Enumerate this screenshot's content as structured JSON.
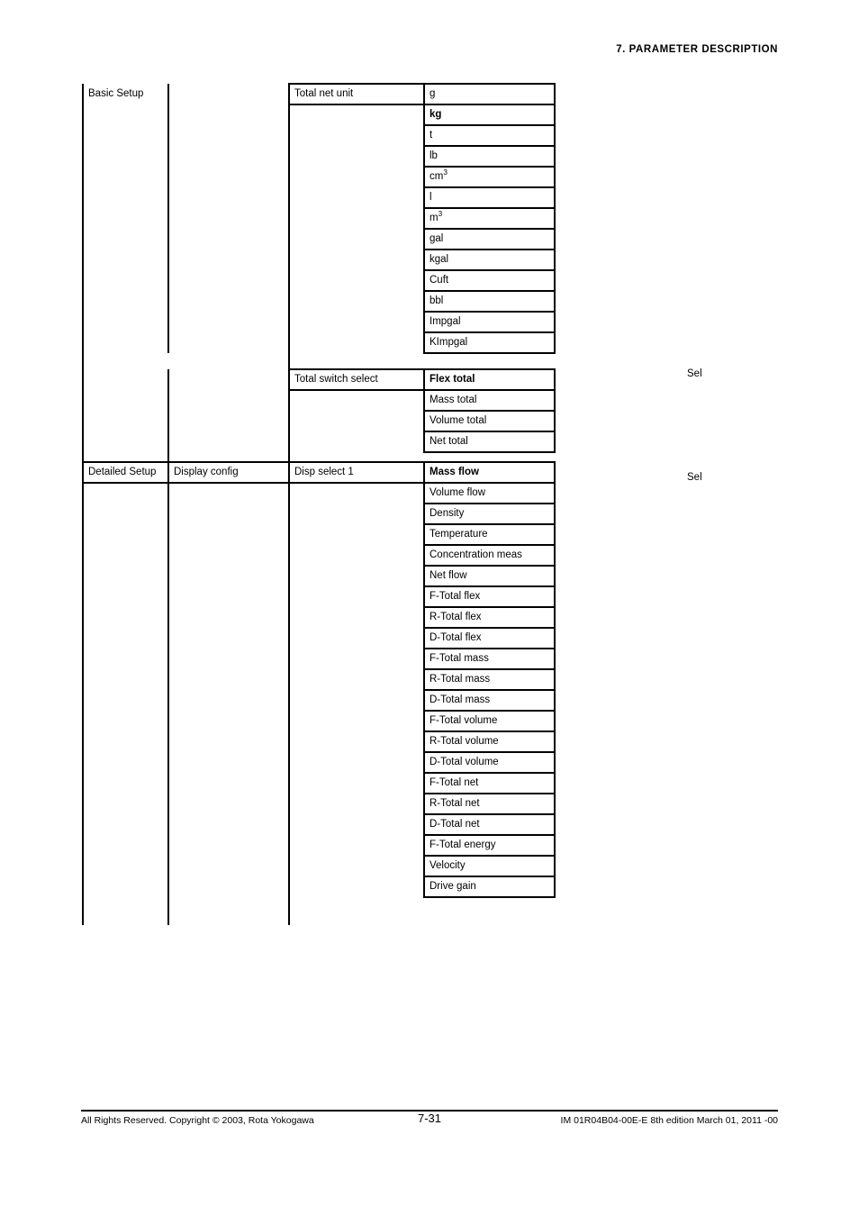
{
  "header": {
    "chapter_title": "7.  PARAMETER DESCRIPTION"
  },
  "sections": [
    {
      "id": "basic-setup",
      "level1": "Basic Setup",
      "level2": "",
      "annotation": "Sel",
      "groups": [
        {
          "parameter": "Total net unit",
          "options": [
            {
              "label": "g",
              "default": false
            },
            {
              "label": "kg",
              "default": true
            },
            {
              "label": "t",
              "default": false
            },
            {
              "label": "lb",
              "default": false
            },
            {
              "label": "cm3",
              "default": false,
              "sup": "3",
              "base": "cm"
            },
            {
              "label": "l",
              "default": false
            },
            {
              "label": "m3",
              "default": false,
              "sup": "3",
              "base": "m"
            },
            {
              "label": "gal",
              "default": false
            },
            {
              "label": "kgal",
              "default": false
            },
            {
              "label": "Cuft",
              "default": false
            },
            {
              "label": "bbl",
              "default": false
            },
            {
              "label": "Impgal",
              "default": false
            },
            {
              "label": "KImpgal",
              "default": false
            }
          ]
        },
        {
          "parameter": "Total switch select",
          "options": [
            {
              "label": "Flex total",
              "default": true
            },
            {
              "label": "Mass total",
              "default": false
            },
            {
              "label": "Volume total",
              "default": false
            },
            {
              "label": "Net total",
              "default": false
            }
          ]
        }
      ]
    },
    {
      "id": "detailed-setup",
      "level1": "Detailed Setup",
      "level2": "Display config",
      "annotation": "Sel",
      "groups": [
        {
          "parameter": "Disp select 1",
          "options": [
            {
              "label": "Mass flow",
              "default": true
            },
            {
              "label": "Volume flow",
              "default": false
            },
            {
              "label": "Density",
              "default": false
            },
            {
              "label": "Temperature",
              "default": false
            },
            {
              "label": "Concentration meas",
              "default": false
            },
            {
              "label": "Net flow",
              "default": false
            },
            {
              "label": "F-Total flex",
              "default": false
            },
            {
              "label": "R-Total flex",
              "default": false
            },
            {
              "label": "D-Total flex",
              "default": false
            },
            {
              "label": "F-Total mass",
              "default": false
            },
            {
              "label": "R-Total mass",
              "default": false
            },
            {
              "label": "D-Total mass",
              "default": false
            },
            {
              "label": "F-Total volume",
              "default": false
            },
            {
              "label": "R-Total volume",
              "default": false
            },
            {
              "label": "D-Total volume",
              "default": false
            },
            {
              "label": "F-Total net",
              "default": false
            },
            {
              "label": "R-Total net",
              "default": false
            },
            {
              "label": "D-Total net",
              "default": false
            },
            {
              "label": "F-Total energy",
              "default": false
            },
            {
              "label": "Velocity",
              "default": false
            },
            {
              "label": "Drive gain",
              "default": false
            }
          ]
        }
      ]
    }
  ],
  "footer": {
    "copyright": "All Rights Reserved. Copyright © 2003, Rota Yokogawa",
    "page_number": "7-31",
    "document_code": "IM 01R04B04-00E-E  8th edition March 01, 2011 -00"
  }
}
